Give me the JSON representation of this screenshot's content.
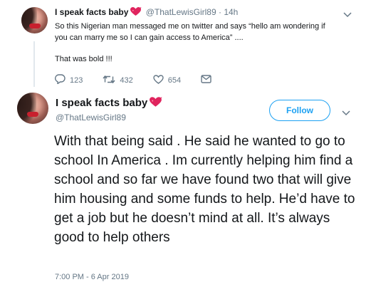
{
  "tweet1": {
    "display_name": "I speak facts baby",
    "handle": "@ThatLewisGirl89",
    "separator": "·",
    "time": "14h",
    "text": "So this Nigerian man messaged me on twitter and says “hello am wondering if you can marry me so I can gain access to America” ....",
    "text2": "That was bold !!!",
    "replies": "123",
    "retweets": "432",
    "likes": "654"
  },
  "tweet2": {
    "display_name": "I speak facts baby",
    "handle": "@ThatLewisGirl89",
    "follow_label": "Follow",
    "text": "With that being said . He said he wanted to go to school In America . Im currently helping him find a school and so far we have found two that will give him housing and some funds to help. He’d have to get a job but he doesn’t mind at all. It’s always good to help others",
    "timestamp": "7:00 PM - 6 Apr 2019"
  },
  "colors": {
    "accent": "#1da1f2",
    "muted": "#657786",
    "heart": "#e0245e"
  },
  "icons": [
    "heart-emoji-icon",
    "reply-icon",
    "retweet-icon",
    "like-icon",
    "dm-icon",
    "chevron-down-icon"
  ]
}
